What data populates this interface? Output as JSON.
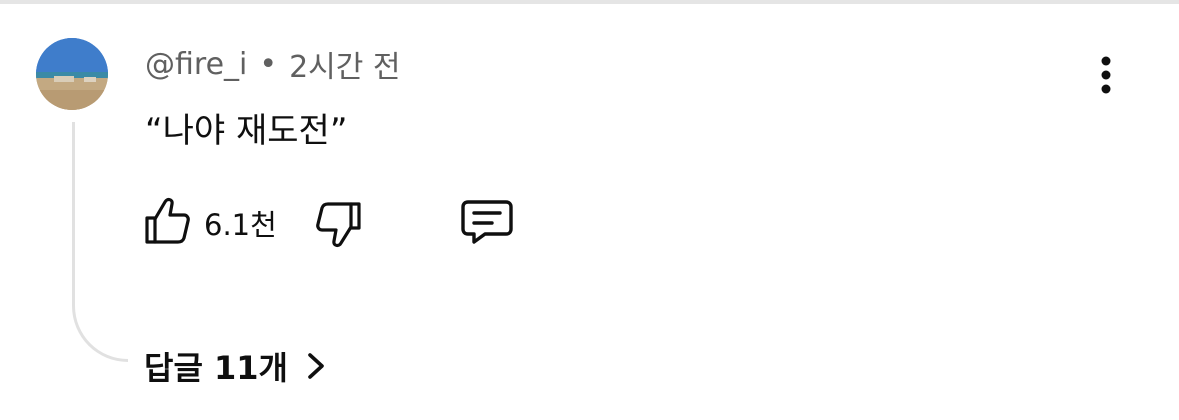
{
  "comment": {
    "author": "@fire_i",
    "separator": "•",
    "time": "2시간 전",
    "text": "“나야 재도전”",
    "like_count": "6.1천",
    "replies_label": "답글 11개"
  },
  "icons": {
    "avatar": "avatar-photo-beach",
    "more": "vertical-dots-icon",
    "like": "thumb-up-icon",
    "dislike": "thumb-down-icon",
    "reply": "comment-icon",
    "chevron": "chevron-right-icon"
  },
  "colors": {
    "text_primary": "#0f0f0f",
    "text_secondary": "#606060",
    "thread_line": "#e1e1e1",
    "background": "#ffffff"
  }
}
